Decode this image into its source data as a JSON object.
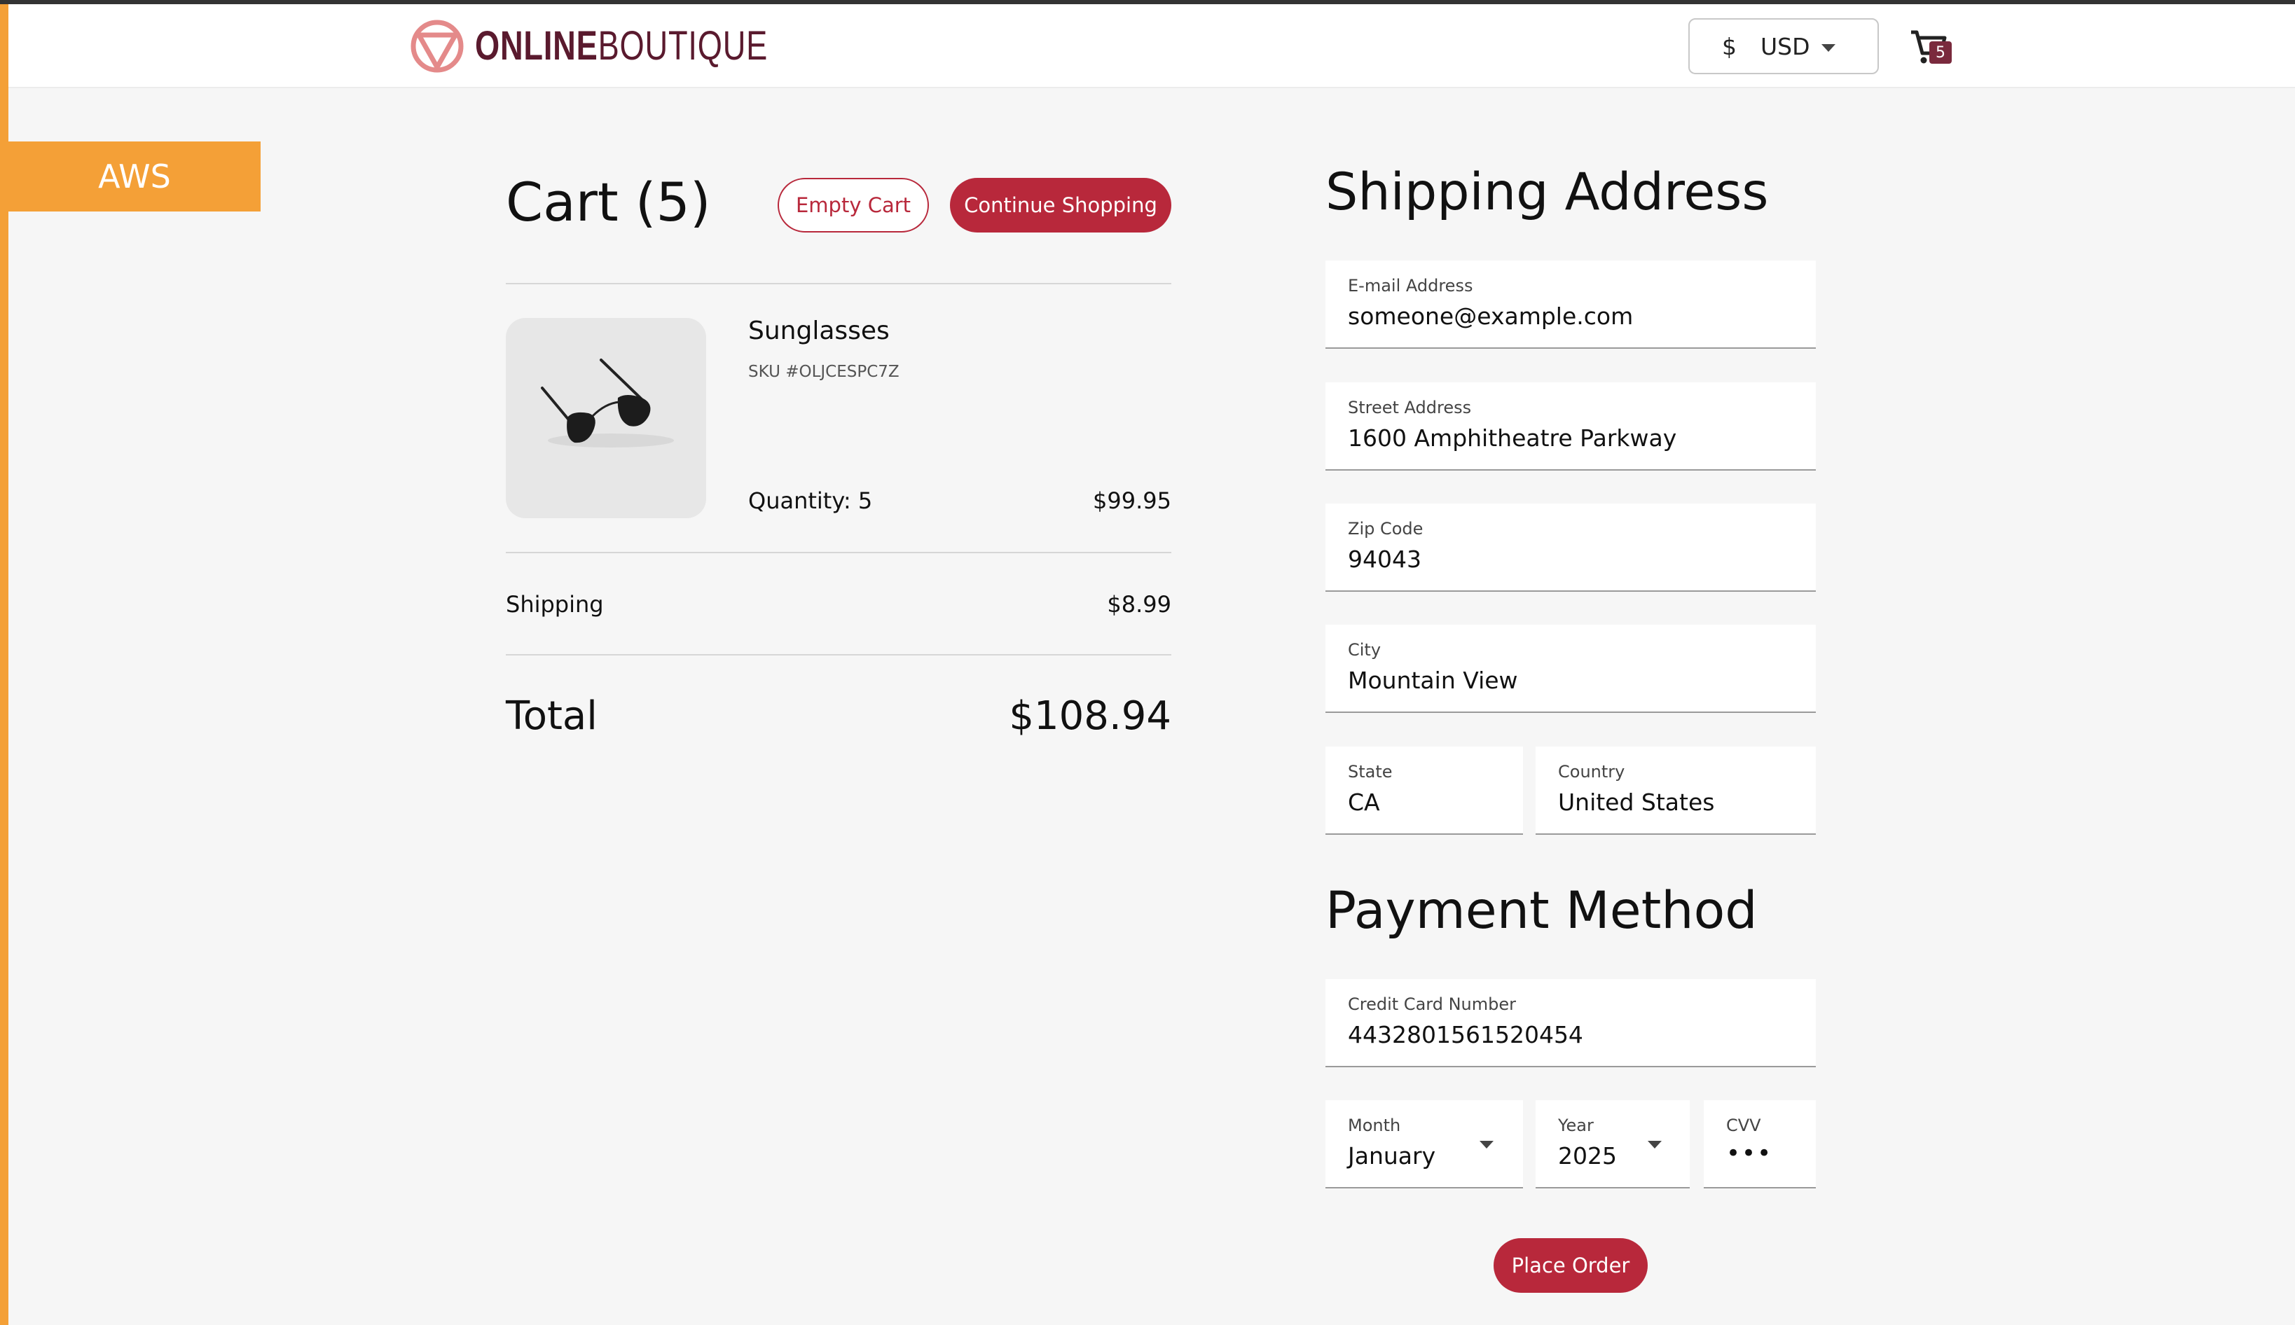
{
  "header": {
    "logo_bold": "ONLINE",
    "logo_light": "BOUTIQUE",
    "currency_symbol": "$",
    "currency_code": "USD",
    "cart_count": "5"
  },
  "env_tag": "AWS",
  "cart": {
    "title": "Cart (5)",
    "empty_label": "Empty Cart",
    "continue_label": "Continue Shopping",
    "item": {
      "name": "Sunglasses",
      "sku": "SKU #OLJCESPC7Z",
      "quantity": "Quantity: 5",
      "price": "$99.95"
    },
    "shipping_label": "Shipping",
    "shipping_value": "$8.99",
    "total_label": "Total",
    "total_value": "$108.94"
  },
  "shipping": {
    "title": "Shipping Address",
    "email_label": "E-mail Address",
    "email_value": "someone@example.com",
    "street_label": "Street Address",
    "street_value": "1600 Amphitheatre Parkway",
    "zip_label": "Zip Code",
    "zip_value": "94043",
    "city_label": "City",
    "city_value": "Mountain View",
    "state_label": "State",
    "state_value": "CA",
    "country_label": "Country",
    "country_value": "United States"
  },
  "payment": {
    "title": "Payment Method",
    "card_label": "Credit Card Number",
    "card_value": "4432801561520454",
    "month_label": "Month",
    "month_value": "January",
    "year_label": "Year",
    "year_value": "2025",
    "cvv_label": "CVV",
    "cvv_value": "•••",
    "place_order_label": "Place Order"
  },
  "colors": {
    "accent": "#b8283b",
    "aws_orange": "#f4a037",
    "logo": "#5a1a2e"
  }
}
